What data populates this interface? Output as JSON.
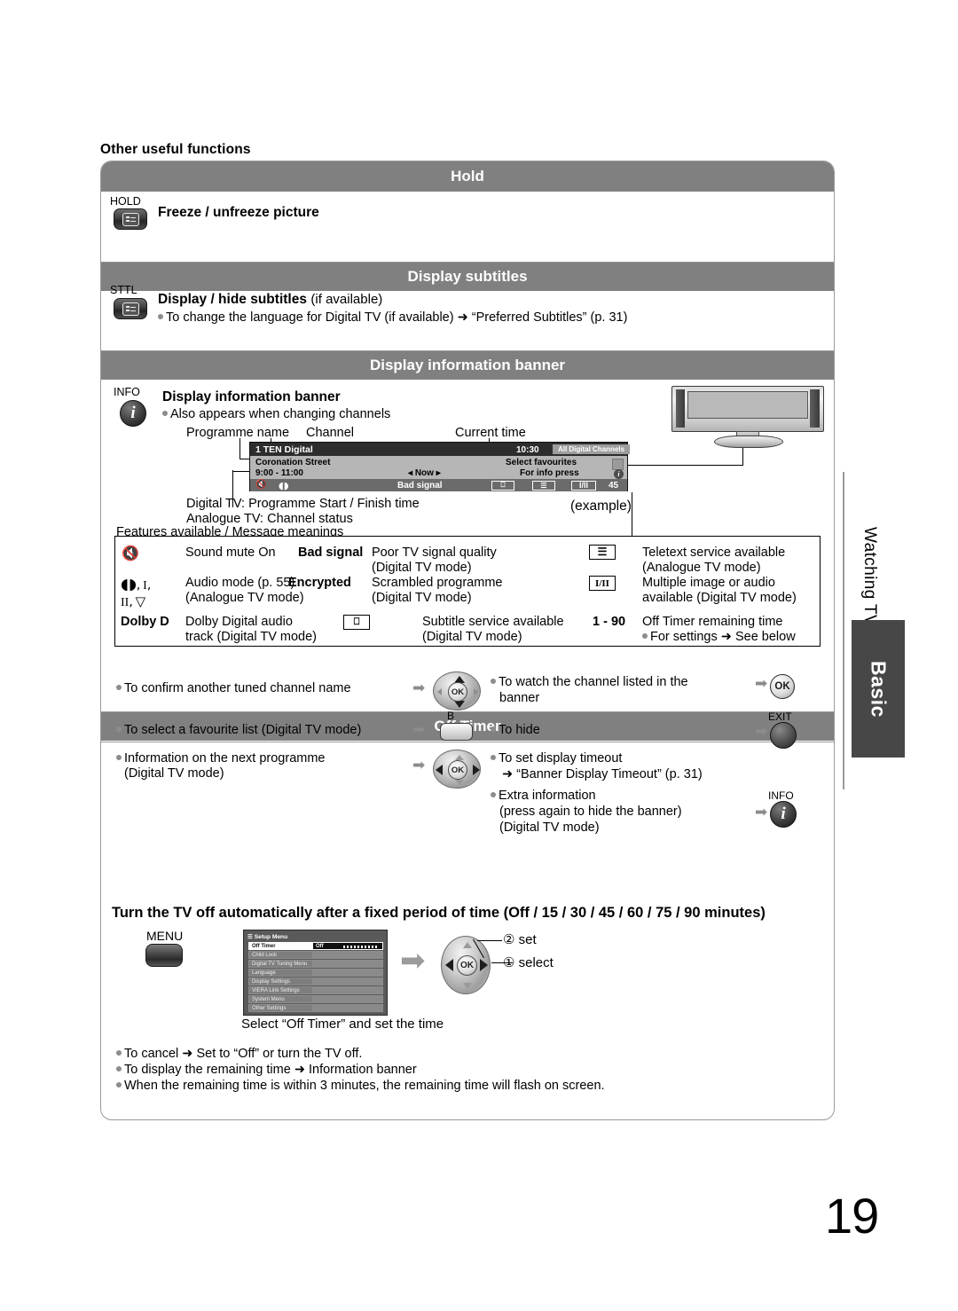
{
  "page": {
    "number": "19",
    "section_heading": "Other useful functions"
  },
  "side_tab": {
    "chapter": "Watching TV",
    "level": "Basic"
  },
  "sections": [
    {
      "id": "hold",
      "title": "Hold",
      "key_label": "HOLD",
      "key_icon": "hold-key-icon",
      "heading": "Freeze / unfreeze picture"
    },
    {
      "id": "subtitles",
      "title": "Display subtitles",
      "key_label": "STTL",
      "key_icon": "subtitle-key-icon",
      "heading_bold": "Display / hide subtitles",
      "heading_rest": "(if available)",
      "bullet": "To change the language for Digital TV (if available) ➜ “Preferred Subtitles” (p. 31)"
    },
    {
      "id": "banner",
      "title": "Display information banner",
      "key_label": "INFO",
      "key_icon": "info-key-icon",
      "heading": "Display information banner",
      "bullet": "Also appears when changing channels"
    },
    {
      "id": "offtimer",
      "title": "Off Timer",
      "heading": "Turn the TV off automatically after a fixed period of time (Off / 15 / 30 / 45 / 60 / 75 / 90 minutes)"
    }
  ],
  "banner_callouts": {
    "programme_name": "Programme name",
    "channel": "Channel",
    "current_time": "Current time",
    "digital_line": "Digital TV: Programme Start / Finish time",
    "analogue_line": "Analogue TV: Channel status",
    "example": "(example)",
    "features_caption": "Features available / Message meanings"
  },
  "osd": {
    "channel": "1 TEN Digital",
    "time": "10:30",
    "channel_list": "All Digital Channels",
    "programme": "Coronation Street",
    "favourites": "Select favourites",
    "timespan": "9:00 - 11:00",
    "now": "Now",
    "for_info": "For info press",
    "status_message": "Bad signal",
    "audio_mode_icon": "I/II",
    "off_timer_value": "45",
    "mute_icon": "mute-icon",
    "stereo_icon": "stereo-icon",
    "subtitle_icon": "subtitle-icon",
    "teletext_icon": "teletext-icon"
  },
  "feature_table": {
    "rows": [
      {
        "c1_symbol": "mute-symbol",
        "c1_text": "Sound mute On",
        "c2_symbol": "Bad signal",
        "c2_text": "Poor TV signal quality",
        "c2_text2": "(Digital TV mode)",
        "c3_symbol": "teletext-symbol",
        "c3_text": "Teletext service available",
        "c3_text2": "(Analogue TV mode)"
      },
      {
        "c1_symbol": "audio-mode-symbols",
        "c1_text": "Audio mode (p. 55)",
        "c1_text2": "(Analogue TV mode)",
        "c2_symbol": "Encrypted",
        "c2_text": "Scrambled programme",
        "c2_text2": "(Digital TV mode)",
        "c3_symbol": "I/II",
        "c3_text": "Multiple image or audio",
        "c3_text2": "available (Digital TV mode)"
      },
      {
        "c1_symbol": "Dolby D",
        "c1_text": "Dolby Digital audio",
        "c1_text2": "track (Digital TV mode)",
        "c2_symbol": "subtitle-symbol",
        "c2_text": "Subtitle service available",
        "c2_text2": "(Digital TV mode)",
        "c3_symbol": "1 - 90",
        "c3_text": "Off Timer remaining time",
        "c3_text2": "For settings ➜ See below"
      }
    ]
  },
  "banner_actions": {
    "left": [
      {
        "text": "To confirm another tuned channel name",
        "control": "dpad-up-down"
      },
      {
        "text": "To select a favourite list (Digital TV mode)",
        "control": "b-button",
        "control_label": "B"
      },
      {
        "text": "Information on the next programme",
        "text2": "(Digital TV mode)",
        "control": "dpad-left-right"
      }
    ],
    "right": [
      {
        "text": "To watch the channel listed in the",
        "text2": "banner",
        "control": "ok-button",
        "control_label": "OK"
      },
      {
        "text": "To hide",
        "control": "exit-button",
        "control_label": "EXIT"
      },
      {
        "text": "To set display timeout",
        "text2": "➜ “Banner Display Timeout” (p. 31)",
        "control": "none"
      },
      {
        "text": "Extra information",
        "text2": "(press again to hide the banner)",
        "text3": "(Digital TV mode)",
        "control": "info-button",
        "control_label": "INFO"
      }
    ]
  },
  "off_timer": {
    "menu_key_label": "MENU",
    "caption": "Select “Off Timer” and set the time",
    "step2": "set",
    "step1": "select",
    "step2_num": "②",
    "step1_num": "①",
    "setup_menu": {
      "title": "Setup Menu",
      "rows": [
        {
          "label": "Off Timer",
          "value": "Off",
          "selected": true
        },
        {
          "label": "Child Lock",
          "value": ""
        },
        {
          "label": "Digital TV Tuning Menu",
          "value": ""
        },
        {
          "label": "Language",
          "value": ""
        },
        {
          "label": "Display Settings",
          "value": ""
        },
        {
          "label": "VIERA Link Settings",
          "value": ""
        },
        {
          "label": "System Menu",
          "value": ""
        },
        {
          "label": "Other Settings",
          "value": ""
        }
      ]
    },
    "notes": [
      "To cancel ➜ Set to “Off” or turn the TV off.",
      "To display the remaining time ➜ Information banner",
      "When the remaining time is within 3 minutes, the remaining time will flash on screen."
    ]
  }
}
